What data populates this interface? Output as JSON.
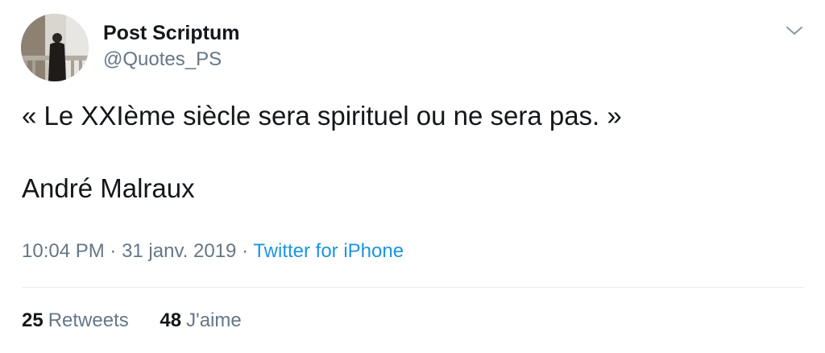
{
  "author": {
    "display_name": "Post Scriptum",
    "handle": "@Quotes_PS"
  },
  "tweet": {
    "text_line1": "« Le XXIème siècle sera spirituel ou ne sera pas. »",
    "text_line2": "André Malraux"
  },
  "meta": {
    "time": "10:04 PM",
    "separator1": " · ",
    "date": "31 janv. 2019",
    "separator2": " · ",
    "source": "Twitter for iPhone"
  },
  "stats": {
    "retweets_count": "25",
    "retweets_label": "Retweets",
    "likes_count": "48",
    "likes_label": "J'aime"
  },
  "icons": {
    "menu": "chevron-down-icon"
  },
  "colors": {
    "text_primary": "#14171a",
    "text_secondary": "#657786",
    "link": "#1b95e0",
    "divider": "#e6ecf0"
  }
}
